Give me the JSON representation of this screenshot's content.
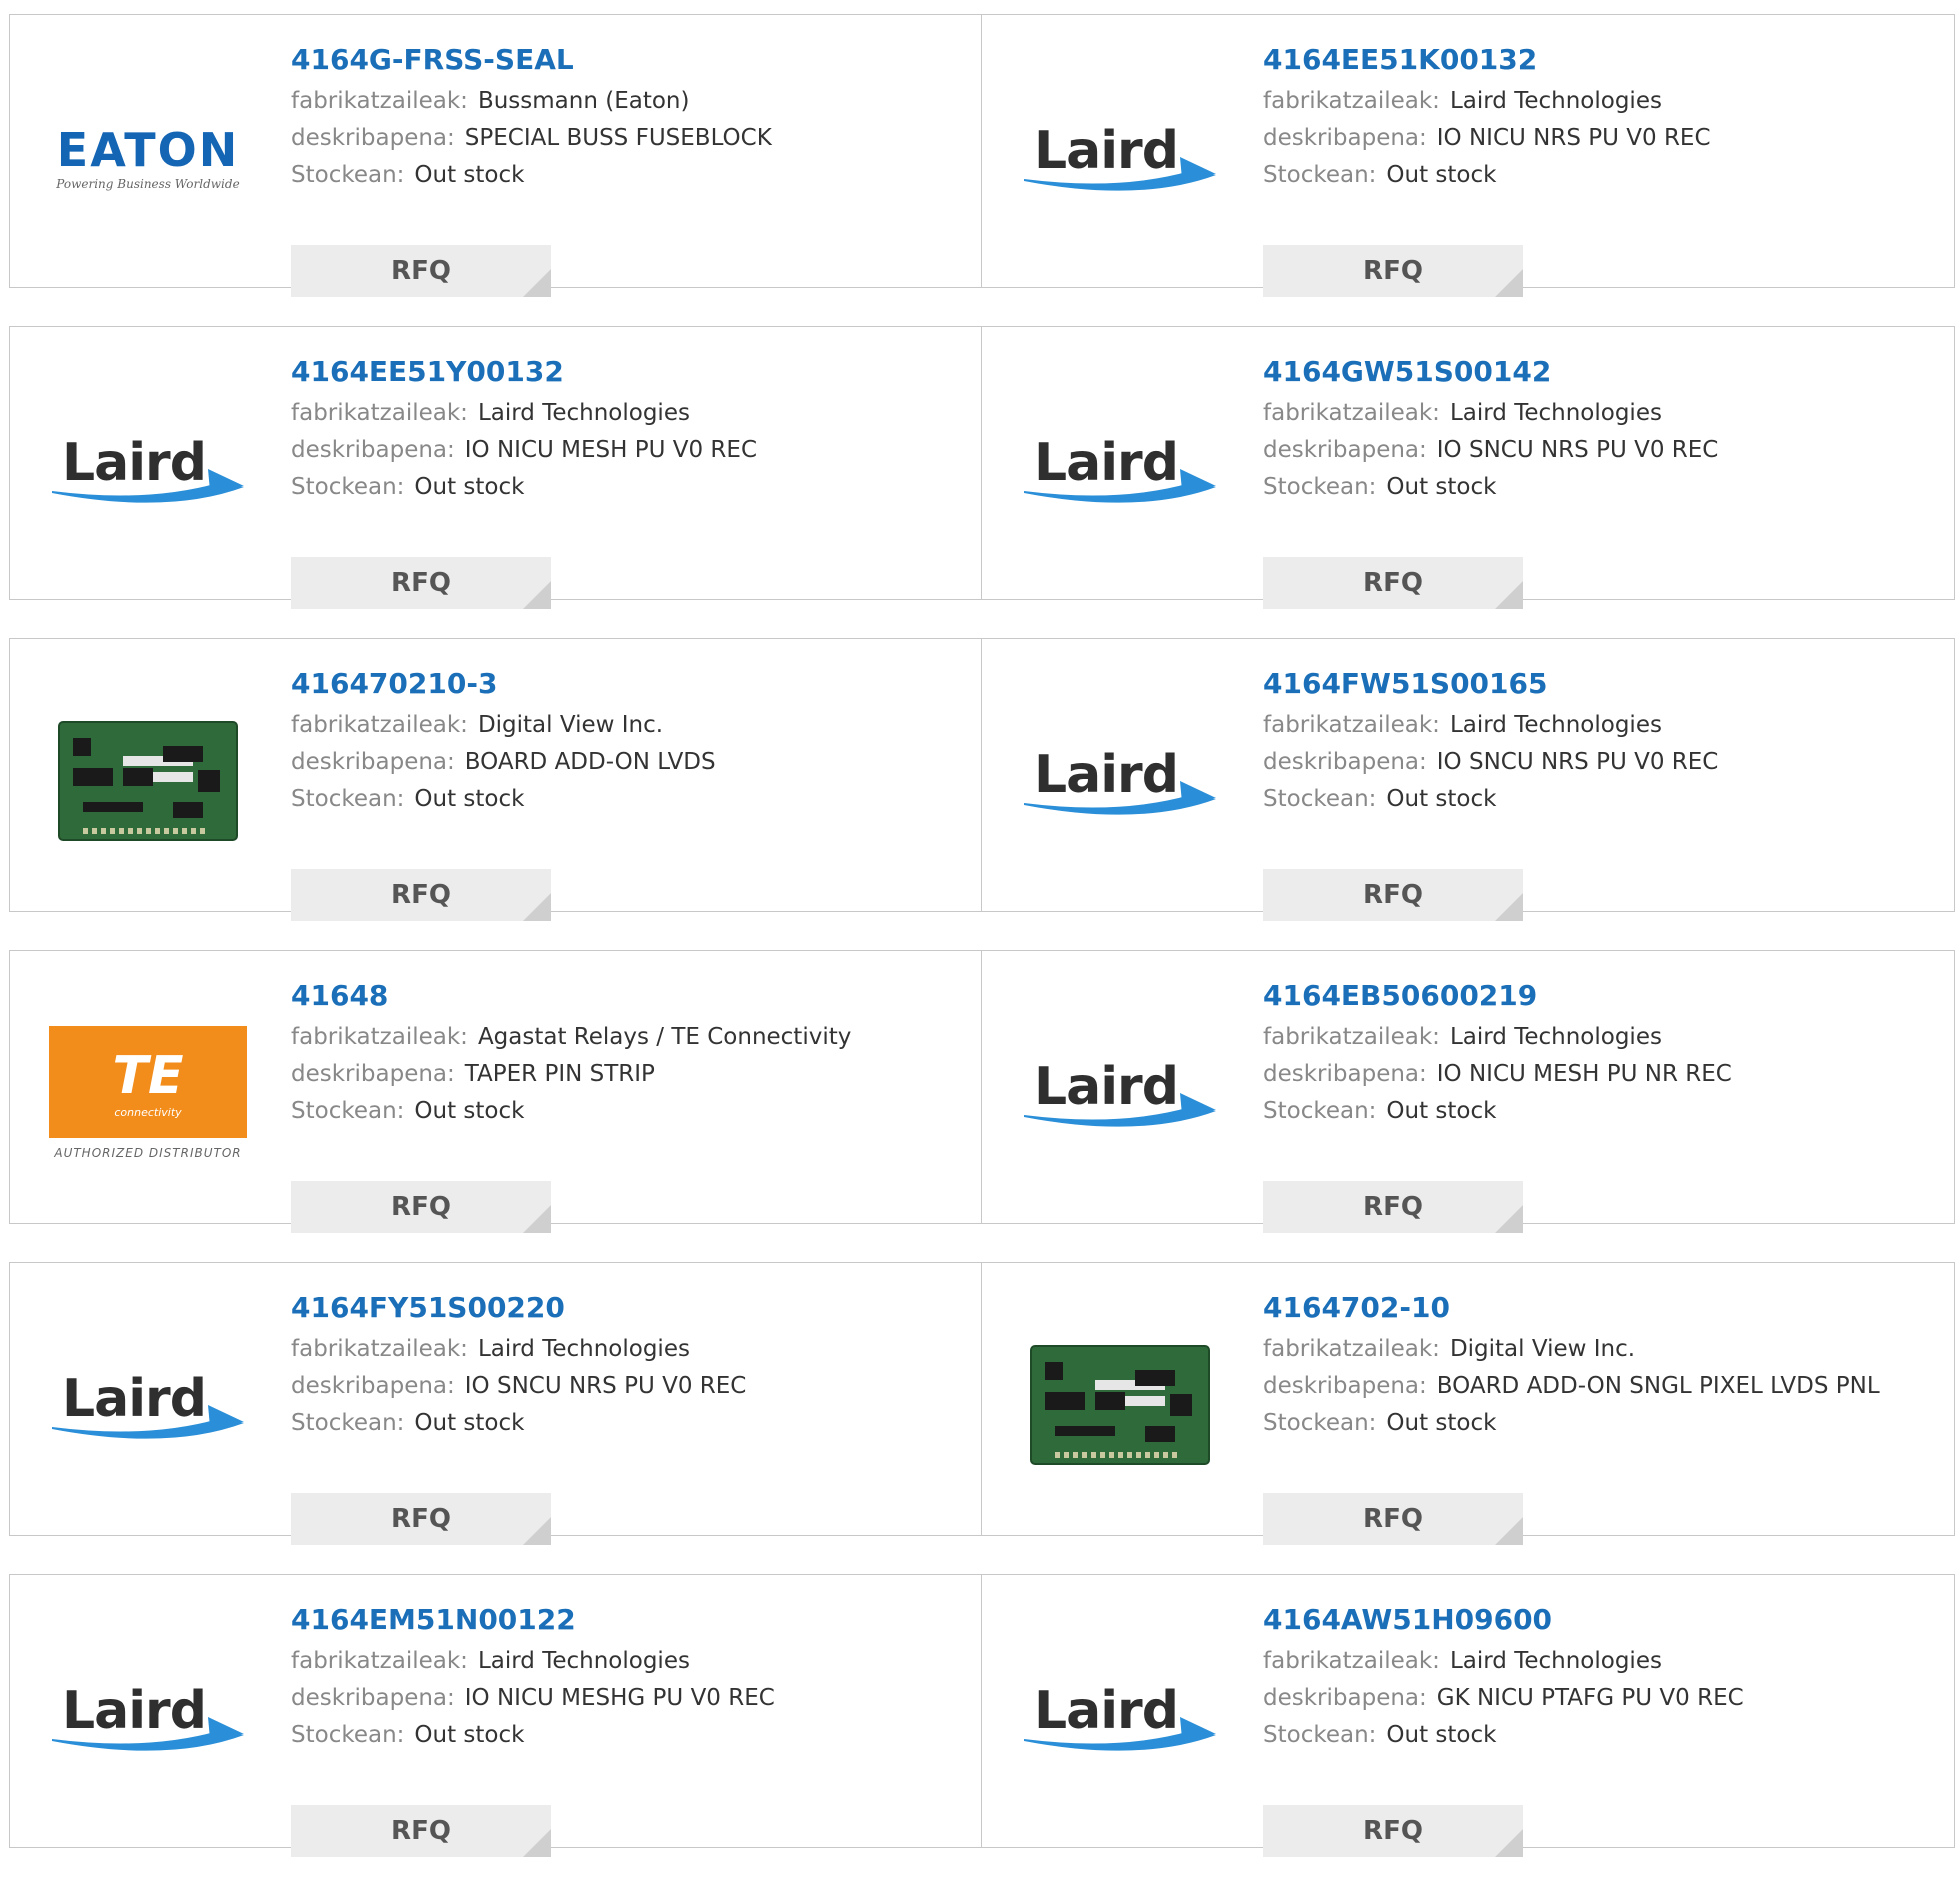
{
  "labels": {
    "manufacturer": "fabrikatzaileak:",
    "description": "deskribapena:",
    "stock": "Stockean:",
    "rfq": "RFQ"
  },
  "products": [
    {
      "part_number": "4164G-FRSS-SEAL",
      "manufacturer": "Bussmann (Eaton)",
      "description": "SPECIAL BUSS FUSEBLOCK",
      "stock": "Out stock",
      "logo": "eaton-logo",
      "logo_text": "EATON",
      "logo_tagline": "Powering Business Worldwide"
    },
    {
      "part_number": "4164EE51K00132",
      "manufacturer": "Laird Technologies",
      "description": "IO NICU NRS PU V0 REC",
      "stock": "Out stock",
      "logo": "laird-logo",
      "logo_text": "Laird"
    },
    {
      "part_number": "4164EE51Y00132",
      "manufacturer": "Laird Technologies",
      "description": "IO NICU MESH PU V0 REC",
      "stock": "Out stock",
      "logo": "laird-logo",
      "logo_text": "Laird"
    },
    {
      "part_number": "4164GW51S00142",
      "manufacturer": "Laird Technologies",
      "description": "IO SNCU NRS PU V0 REC",
      "stock": "Out stock",
      "logo": "laird-logo",
      "logo_text": "Laird"
    },
    {
      "part_number": "416470210-3",
      "manufacturer": "Digital View Inc.",
      "description": "BOARD ADD-ON LVDS",
      "stock": "Out stock",
      "logo": "circuit-board-image"
    },
    {
      "part_number": "4164FW51S00165",
      "manufacturer": "Laird Technologies",
      "description": "IO SNCU NRS PU V0 REC",
      "stock": "Out stock",
      "logo": "laird-logo",
      "logo_text": "Laird"
    },
    {
      "part_number": "41648",
      "manufacturer": "Agastat Relays / TE Connectivity",
      "description": "TAPER PIN STRIP",
      "stock": "Out stock",
      "logo": "te-logo",
      "logo_text": "TE",
      "logo_sub": "connectivity",
      "logo_tagline": "AUTHORIZED DISTRIBUTOR"
    },
    {
      "part_number": "4164EB50600219",
      "manufacturer": "Laird Technologies",
      "description": "IO NICU MESH PU NR REC",
      "stock": "Out stock",
      "logo": "laird-logo",
      "logo_text": "Laird"
    },
    {
      "part_number": "4164FY51S00220",
      "manufacturer": "Laird Technologies",
      "description": "IO SNCU NRS PU V0 REC",
      "stock": "Out stock",
      "logo": "laird-logo",
      "logo_text": "Laird"
    },
    {
      "part_number": "4164702-10",
      "manufacturer": "Digital View Inc.",
      "description": "BOARD ADD-ON SNGL PIXEL LVDS PNL",
      "stock": "Out stock",
      "logo": "circuit-board-image"
    },
    {
      "part_number": "4164EM51N00122",
      "manufacturer": "Laird Technologies",
      "description": "IO NICU MESHG PU V0 REC",
      "stock": "Out stock",
      "logo": "laird-logo",
      "logo_text": "Laird"
    },
    {
      "part_number": "4164AW51H09600",
      "manufacturer": "Laird Technologies",
      "description": "GK NICU PTAFG PU V0 REC",
      "stock": "Out stock",
      "logo": "laird-logo",
      "logo_text": "Laird"
    }
  ],
  "colors": {
    "link": "#1a6fb8",
    "label": "#888888",
    "value": "#333333",
    "button_bg": "#ececec",
    "laird_swoosh": "#2a8fd8",
    "te_orange": "#f28c1a",
    "eaton_blue": "#1565b5"
  }
}
